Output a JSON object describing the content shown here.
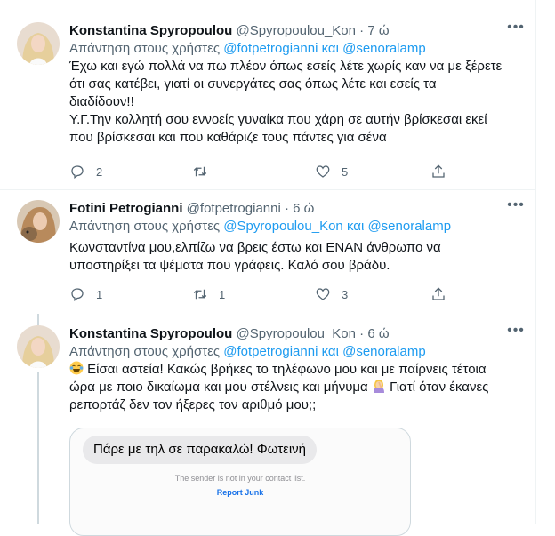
{
  "tweets": [
    {
      "name": "Konstantina Spyropoulou",
      "handle": "@Spyropoulou_Kon",
      "dot": "·",
      "time": "7 ώ",
      "reply_prefix": "Απάντηση στους χρήστες",
      "mention1": "@fotpetrogianni",
      "reply_and": "και",
      "mention2": "@senoralamp",
      "lines": [
        "Έχω και εγώ πολλά να πω πλέον όπως εσείς λέτε χωρίς καν να με ξέρετε",
        "ότι σας κατέβει, γιατί οι συνεργάτες σας όπως λέτε και εσείς τα",
        "διαδίδουν!!",
        "Υ.Γ.Την κολλητή σου εννοείς γυναίκα που χάρη σε αυτήν βρίσκεσαι εκεί",
        "που βρίσκεσαι και που καθάριζε τους πάντες για σένα"
      ],
      "replies": "2",
      "retweets": "",
      "likes": "5"
    },
    {
      "name": "Fotini Petrogianni",
      "handle": "@fotpetrogianni",
      "dot": "·",
      "time": "6 ώ",
      "reply_prefix": "Απάντηση στους χρήστες",
      "mention1": "@Spyropoulou_Kon",
      "reply_and": "και",
      "mention2": "@senoralamp",
      "lines": [
        "Κωνσταντίνα μου,ελπίζω να βρεις έστω και ΕΝΑΝ άνθρωπο να",
        "υποστηρίξει τα ψέματα που γράφεις. Καλό σου βράδυ."
      ],
      "replies": "1",
      "retweets": "1",
      "likes": "3"
    },
    {
      "name": "Konstantina Spyropoulou",
      "handle": "@Spyropoulou_Kon",
      "dot": "·",
      "time": "6 ώ",
      "reply_prefix": "Απάντηση στους χρήστες",
      "mention1": "@fotpetrogianni",
      "reply_and": "και",
      "mention2": "@senoralamp",
      "line1": "Είσαι αστεία! Κακώς βρήκες το τηλέφωνο μου και με παίρνεις τέτοια",
      "line2": "ώρα με ποιο δικαίωμα και μου στέλνεις και μήνυμα",
      "line2b": "Γιατί όταν έκανες",
      "line3": "ρεπορτάζ δεν τον ήξερες τον αριθμό μου;;",
      "media": {
        "bubble_text": "Πάρε με τηλ σε παρακαλώ! Φωτεινή",
        "note": "The sender is not in your contact list.",
        "link": "Report Junk"
      }
    }
  ],
  "icons": [
    "reply-icon",
    "retweet-icon",
    "like-icon",
    "share-icon",
    "more-icon",
    "laughing-emoji",
    "facepalm-emoji"
  ],
  "colors": {
    "mention": "#1d9bf0",
    "muted": "#536471",
    "text": "#0f1419",
    "border": "#eff3f4"
  }
}
